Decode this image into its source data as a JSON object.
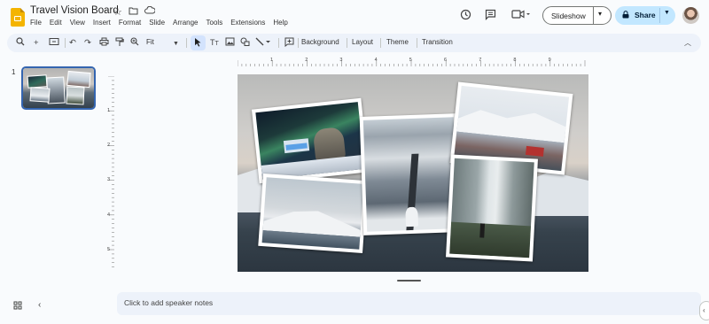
{
  "app": {
    "doc_title": "Travel Vision Board"
  },
  "menu": [
    "File",
    "Edit",
    "View",
    "Insert",
    "Format",
    "Slide",
    "Arrange",
    "Tools",
    "Extensions",
    "Help"
  ],
  "header": {
    "slideshow_label": "Slideshow",
    "share_label": "Share"
  },
  "toolbar": {
    "zoom_label": "Fit",
    "background_label": "Background",
    "layout_label": "Layout",
    "theme_label": "Theme",
    "transition_label": "Transition"
  },
  "filmstrip": {
    "slide_number": "1"
  },
  "ruler": {
    "h_ticks": [
      "1",
      "2",
      "3",
      "4",
      "5",
      "6",
      "7",
      "8",
      "9"
    ],
    "v_ticks": [
      "1",
      "2",
      "3",
      "4",
      "5"
    ]
  },
  "notes": {
    "placeholder": "Click to add speaker notes"
  },
  "icons": {
    "search": "search-icon",
    "add": "plus-icon",
    "undo": "undo-icon",
    "redo": "redo-icon",
    "print": "print-icon",
    "paint_format": "paint-format-icon",
    "zoom": "zoom-icon",
    "select": "cursor-icon",
    "textbox": "textbox-icon",
    "image": "image-icon",
    "shape": "shape-icon",
    "line": "line-icon",
    "comment": "comment-add-icon",
    "collapse": "chevron-up-icon",
    "history": "history-icon",
    "comments": "comments-icon",
    "meet": "camera-icon",
    "star": "star-icon",
    "move": "folder-icon",
    "cloud": "cloud-icon",
    "grid": "grid-view-icon",
    "hide_panel": "chevron-left-icon",
    "expand": "chevron-right-icon"
  },
  "colors": {
    "accent": "#0b57d0",
    "share_bg": "#c2e7ff",
    "toolbar_bg": "#edf2fa",
    "logo": "#f4b400"
  }
}
